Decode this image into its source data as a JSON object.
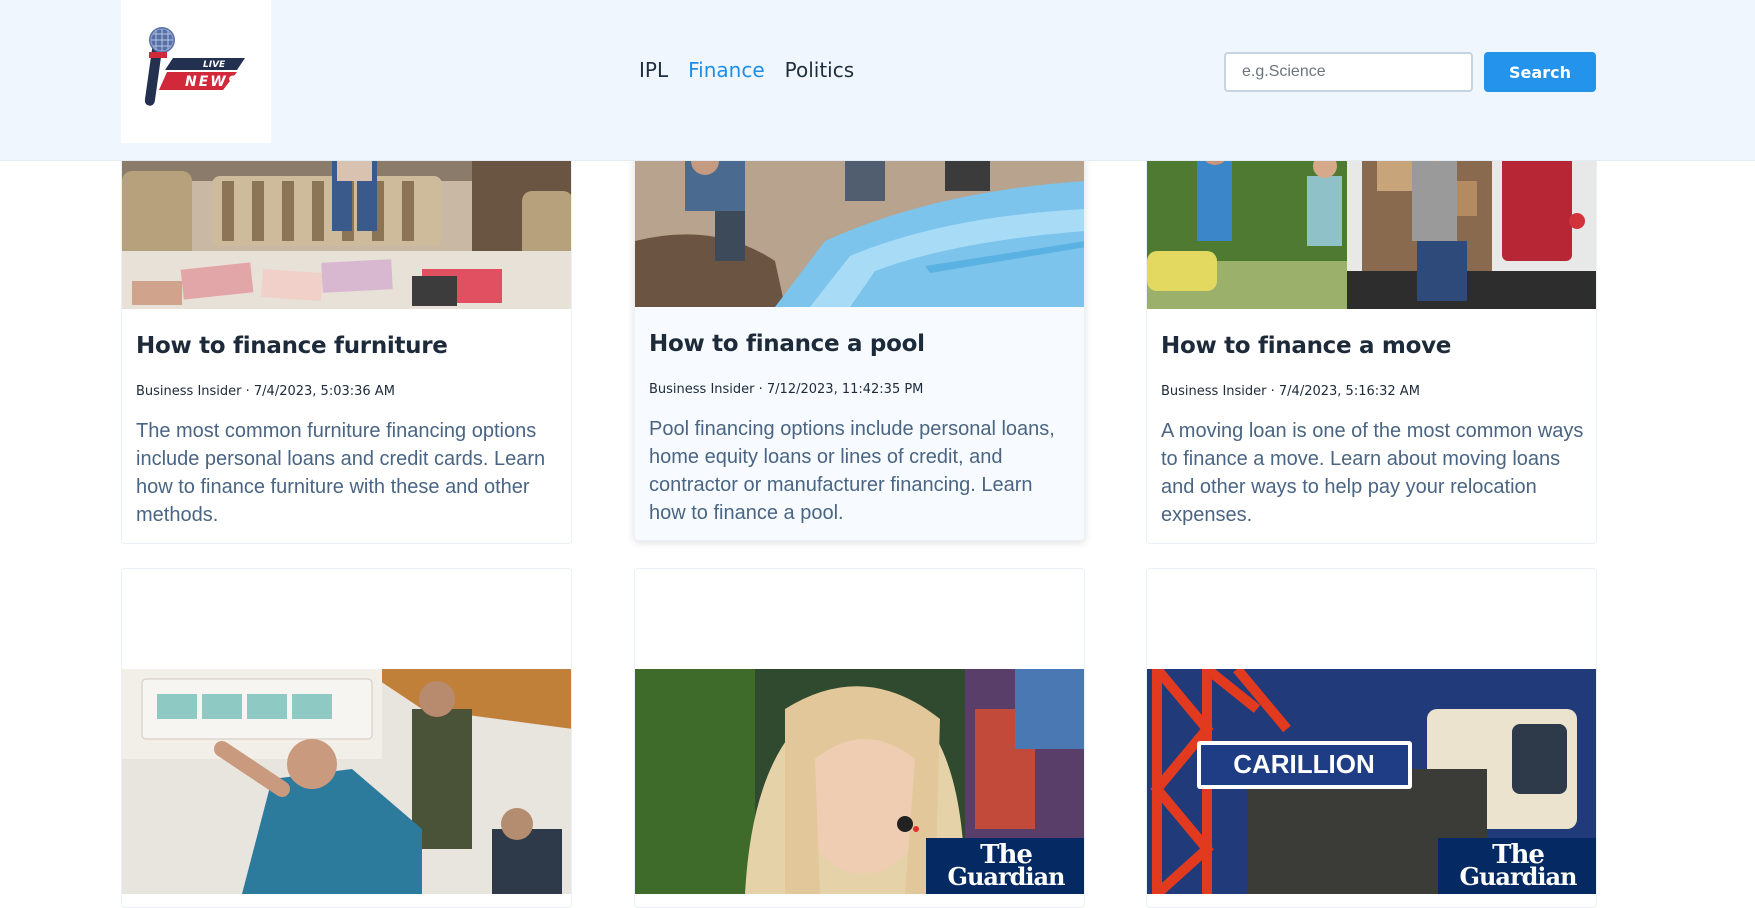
{
  "header": {
    "logo": {
      "text_top": "LIVE",
      "text_bottom": "NEWS"
    },
    "nav": [
      {
        "label": "IPL",
        "active": false
      },
      {
        "label": "Finance",
        "active": true
      },
      {
        "label": "Politics",
        "active": false
      }
    ],
    "search": {
      "placeholder": "e.g.Science",
      "button_label": "Search"
    }
  },
  "cards": [
    {
      "title": "How to finance furniture",
      "meta": "Business Insider · 7/4/2023, 5:03:36 AM",
      "description": "The most common furniture financing options include personal loans and credit cards. Learn how to finance furniture with these and other methods."
    },
    {
      "title": "How to finance a pool",
      "meta": "Business Insider · 7/12/2023, 11:42:35 PM",
      "description": "Pool financing options include personal loans, home equity loans or lines of credit, and contractor or manufacturer financing. Learn how to finance a pool."
    },
    {
      "title": "How to finance a move",
      "meta": "Business Insider · 7/4/2023, 5:16:32 AM",
      "description": "A moving loan is one of the most common ways to finance a move. Learn about moving loans and other ways to help pay your relocation expenses."
    }
  ],
  "second_row": [
    {
      "image": "air-conditioner-installation-photo"
    },
    {
      "image": "woman-portrait-photo",
      "badge": {
        "line1": "The",
        "line2": "Guardian"
      }
    },
    {
      "image": "carillion-crane-photo",
      "sign": "CARILLION",
      "badge": {
        "line1": "The",
        "line2": "Guardian"
      }
    }
  ],
  "colors": {
    "accent": "#2393ec",
    "nav_active": "#1e8fe9",
    "header_bg": "#eff6fd",
    "guardian": "#052962"
  }
}
